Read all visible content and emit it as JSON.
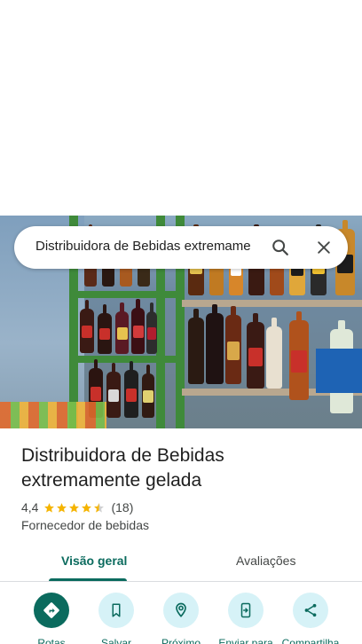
{
  "search": {
    "query": "Distribuidora de Bebidas extremame"
  },
  "place": {
    "title": "Distribuidora de Bebidas extremamente gelada",
    "rating": "4,4",
    "star_fraction": 0.88,
    "review_count": "(18)",
    "category": "Fornecedor de bebidas"
  },
  "tabs": [
    {
      "label": "Visão geral",
      "selected": true
    },
    {
      "label": "Avaliações",
      "selected": false
    }
  ],
  "actions": [
    {
      "label": "Rotas",
      "icon": "directions-icon"
    },
    {
      "label": "Salvar",
      "icon": "bookmark-icon"
    },
    {
      "label": "Próximo",
      "icon": "nearby-icon"
    },
    {
      "label": "Enviar para",
      "icon": "send-to-phone-icon"
    },
    {
      "label": "Compartilha",
      "icon": "share-icon"
    }
  ],
  "colors": {
    "accent": "#0b6b5e",
    "action_bg": "#d6f2f7",
    "star": "#f5b400"
  }
}
